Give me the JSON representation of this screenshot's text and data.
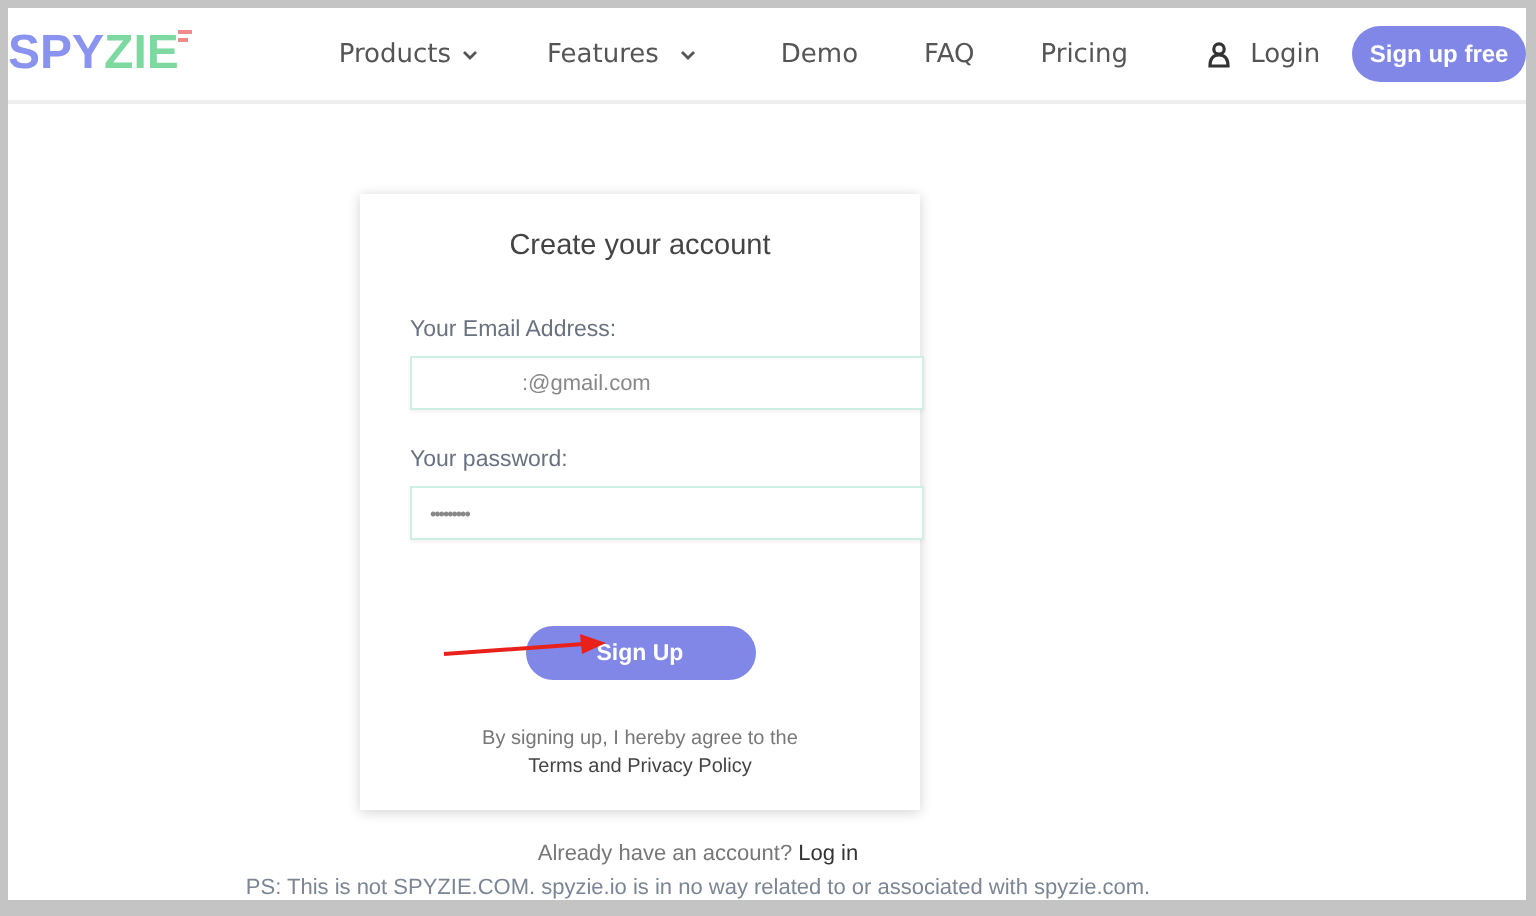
{
  "header": {
    "logo": {
      "first": "SPY",
      "second": "ZIE"
    },
    "nav": [
      {
        "label": "Products",
        "kind": "dropdown"
      },
      {
        "label": "Features",
        "kind": "dropdown"
      },
      {
        "label": "Demo",
        "kind": "link"
      },
      {
        "label": "FAQ",
        "kind": "link"
      },
      {
        "label": "Pricing",
        "kind": "link"
      }
    ],
    "login": "Login",
    "signup_button": "Sign up free"
  },
  "form": {
    "title": "Create your account",
    "fields": [
      {
        "label": "Your Email Address:",
        "value": ":@gmail.com"
      },
      {
        "label": "Your password:",
        "value": "•••••••••"
      }
    ],
    "submit": "Sign Up",
    "terms": {
      "text": "By signing up, I hereby agree to the",
      "link": "Terms and Privacy Policy"
    }
  },
  "login_prompt": {
    "text": "Already have an account?",
    "link": "Log in"
  },
  "disclaimer": "PS: This is not SPYZIE.COM. spyzie.io is in no way related to or associated with spyzie.com.",
  "annotation": {
    "kind": "arrow"
  }
}
